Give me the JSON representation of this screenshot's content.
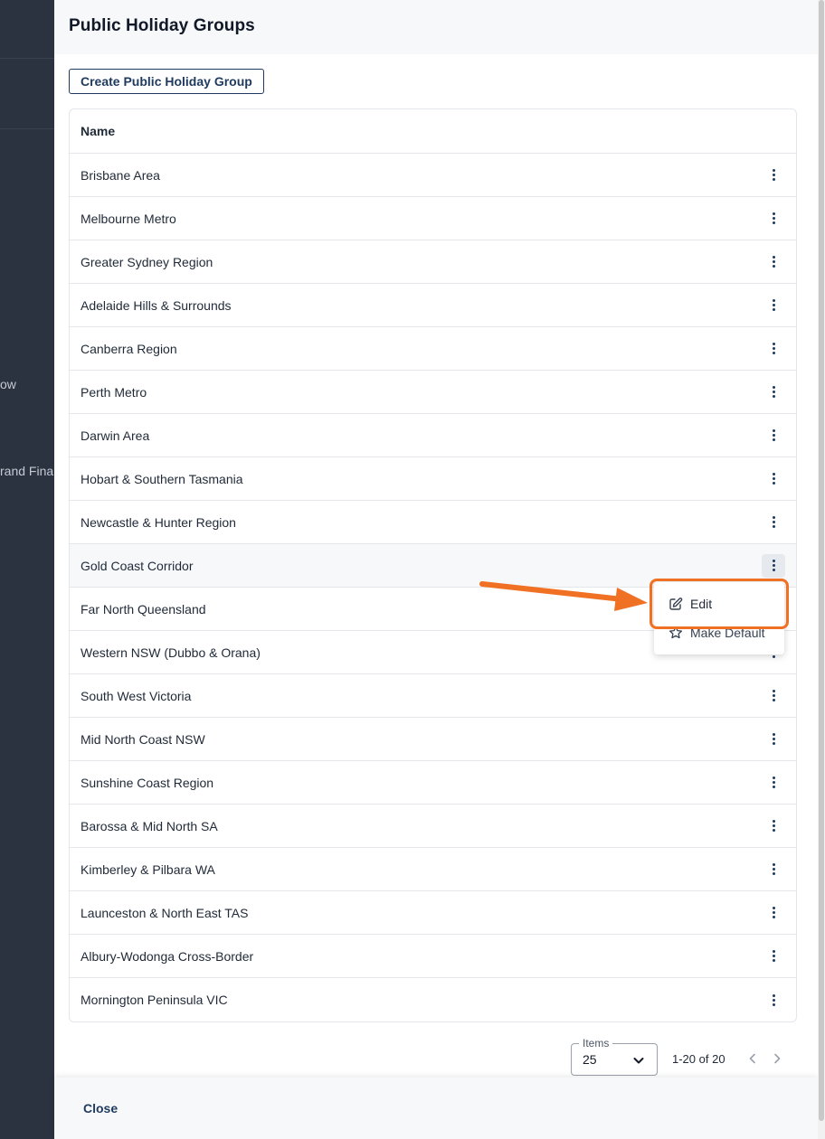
{
  "background": {
    "fragments": [
      "ow",
      "rand Fina"
    ]
  },
  "modal": {
    "title": "Public Holiday Groups",
    "create_button_label": "Create Public Holiday Group",
    "table": {
      "column_name": "Name",
      "rows": [
        "Brisbane Area",
        "Melbourne Metro",
        "Greater Sydney Region",
        "Adelaide Hills & Surrounds",
        "Canberra Region",
        "Perth Metro",
        "Darwin Area",
        "Hobart & Southern Tasmania",
        "Newcastle & Hunter Region",
        "Gold Coast Corridor",
        "Far North Queensland",
        "Western NSW (Dubbo & Orana)",
        "South West Victoria",
        "Mid North Coast NSW",
        "Sunshine Coast Region",
        "Barossa & Mid North SA",
        "Kimberley & Pilbara WA",
        "Launceston & North East TAS",
        "Albury-Wodonga Cross-Border",
        "Mornington Peninsula VIC"
      ]
    },
    "row_menu": {
      "edit_label": "Edit",
      "make_default_label": "Make Default"
    },
    "pagination": {
      "items_label": "Items",
      "items_value": "25",
      "range_text": "1-20 of 20"
    },
    "footer": {
      "close_label": "Close"
    }
  },
  "colors": {
    "accent": "#1e3a5f",
    "annotation": "#f07123",
    "backdrop": "#2b3240"
  },
  "icons": [
    "kebab-menu-icon",
    "edit-icon",
    "star-icon",
    "chevron-down-icon",
    "chevron-left-icon",
    "chevron-right-icon",
    "annotation-arrow"
  ]
}
